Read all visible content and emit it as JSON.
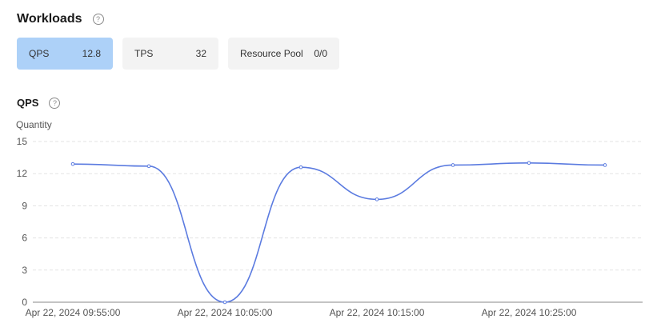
{
  "header": {
    "title": "Workloads",
    "help_icon": "question-circle-icon",
    "help_glyph": "?"
  },
  "cards": [
    {
      "label": "QPS",
      "value": "12.8",
      "active": true
    },
    {
      "label": "TPS",
      "value": "32",
      "active": false
    },
    {
      "label": "Resource Pool",
      "value": "0/0",
      "active": false
    }
  ],
  "colors": {
    "active_card": "#add1f8",
    "card": "#f3f3f3",
    "line": "#5b7be0"
  },
  "chart_section": {
    "title": "QPS",
    "help_icon": "question-circle-icon",
    "help_glyph": "?"
  },
  "chart_data": {
    "type": "line",
    "ylabel": "Quantity",
    "ylim": [
      0,
      15
    ],
    "yticks": [
      0,
      3,
      6,
      9,
      12,
      15
    ],
    "xticks": [
      "Apr 22, 2024 09:55:00",
      "Apr 22, 2024 10:05:00",
      "Apr 22, 2024 10:15:00",
      "Apr 22, 2024 10:25:00"
    ],
    "x": [
      "Apr 22, 2024 09:55:00",
      "Apr 22, 2024 10:00:00",
      "Apr 22, 2024 10:05:00",
      "Apr 22, 2024 10:10:00",
      "Apr 22, 2024 10:15:00",
      "Apr 22, 2024 10:20:00",
      "Apr 22, 2024 10:25:00",
      "Apr 22, 2024 10:30:00"
    ],
    "series": [
      {
        "values": [
          12.9,
          12.7,
          0,
          12.6,
          9.6,
          12.8,
          13.0,
          12.8
        ]
      }
    ],
    "grid": true,
    "smooth": true
  }
}
